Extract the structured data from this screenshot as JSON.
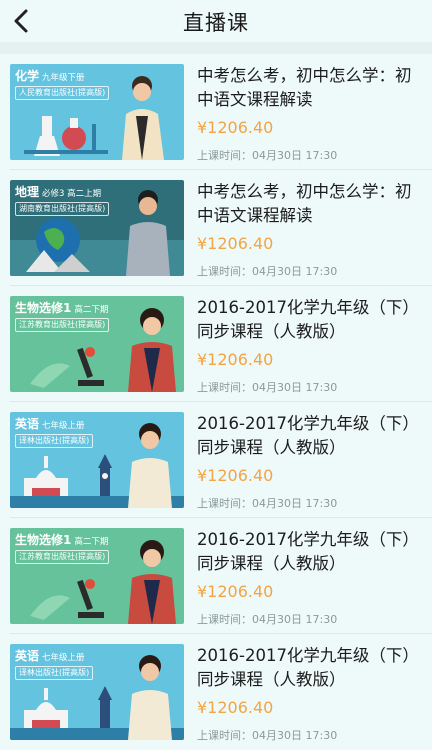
{
  "header": {
    "title": "直播课",
    "back_icon": "back-chevron-icon"
  },
  "courses": [
    {
      "subject": "化学",
      "grade": "九年级下册",
      "publisher": "人民教育出版社(提高版)",
      "title": "中考怎么考，初中怎么学：初中语文课程解读",
      "price": "¥1206.40",
      "time": "上课时间：04月30日 17:30",
      "thumb_style": "blue"
    },
    {
      "subject": "地理",
      "grade": "必修3 高二上期",
      "publisher": "湖南教育出版社(提高版)",
      "title": "中考怎么考，初中怎么学：初中语文课程解读",
      "price": "¥1206.40",
      "time": "上课时间：04月30日 17:30",
      "thumb_style": "teal"
    },
    {
      "subject": "生物选修1",
      "grade": "高二下期",
      "publisher": "江苏教育出版社(提高版)",
      "title": "2016-2017化学九年级（下）同步课程（人教版）",
      "price": "¥1206.40",
      "time": "上课时间：04月30日 17:30",
      "thumb_style": "green"
    },
    {
      "subject": "英语",
      "grade": "七年级上册",
      "publisher": "译林出版社(提高版)",
      "title": "2016-2017化学九年级（下）同步课程（人教版）",
      "price": "¥1206.40",
      "time": "上课时间：04月30日 17:30",
      "thumb_style": "blue"
    },
    {
      "subject": "生物选修1",
      "grade": "高二下期",
      "publisher": "江苏教育出版社(提高版)",
      "title": "2016-2017化学九年级（下）同步课程（人教版）",
      "price": "¥1206.40",
      "time": "上课时间：04月30日 17:30",
      "thumb_style": "green"
    },
    {
      "subject": "英语",
      "grade": "七年级上册",
      "publisher": "译林出版社(提高版)",
      "title": "2016-2017化学九年级（下）同步课程（人教版）",
      "price": "¥1206.40",
      "time": "上课时间：04月30日 17:30",
      "thumb_style": "blue"
    }
  ],
  "colors": {
    "price": "#f3a443",
    "background": "#eef9f9"
  }
}
